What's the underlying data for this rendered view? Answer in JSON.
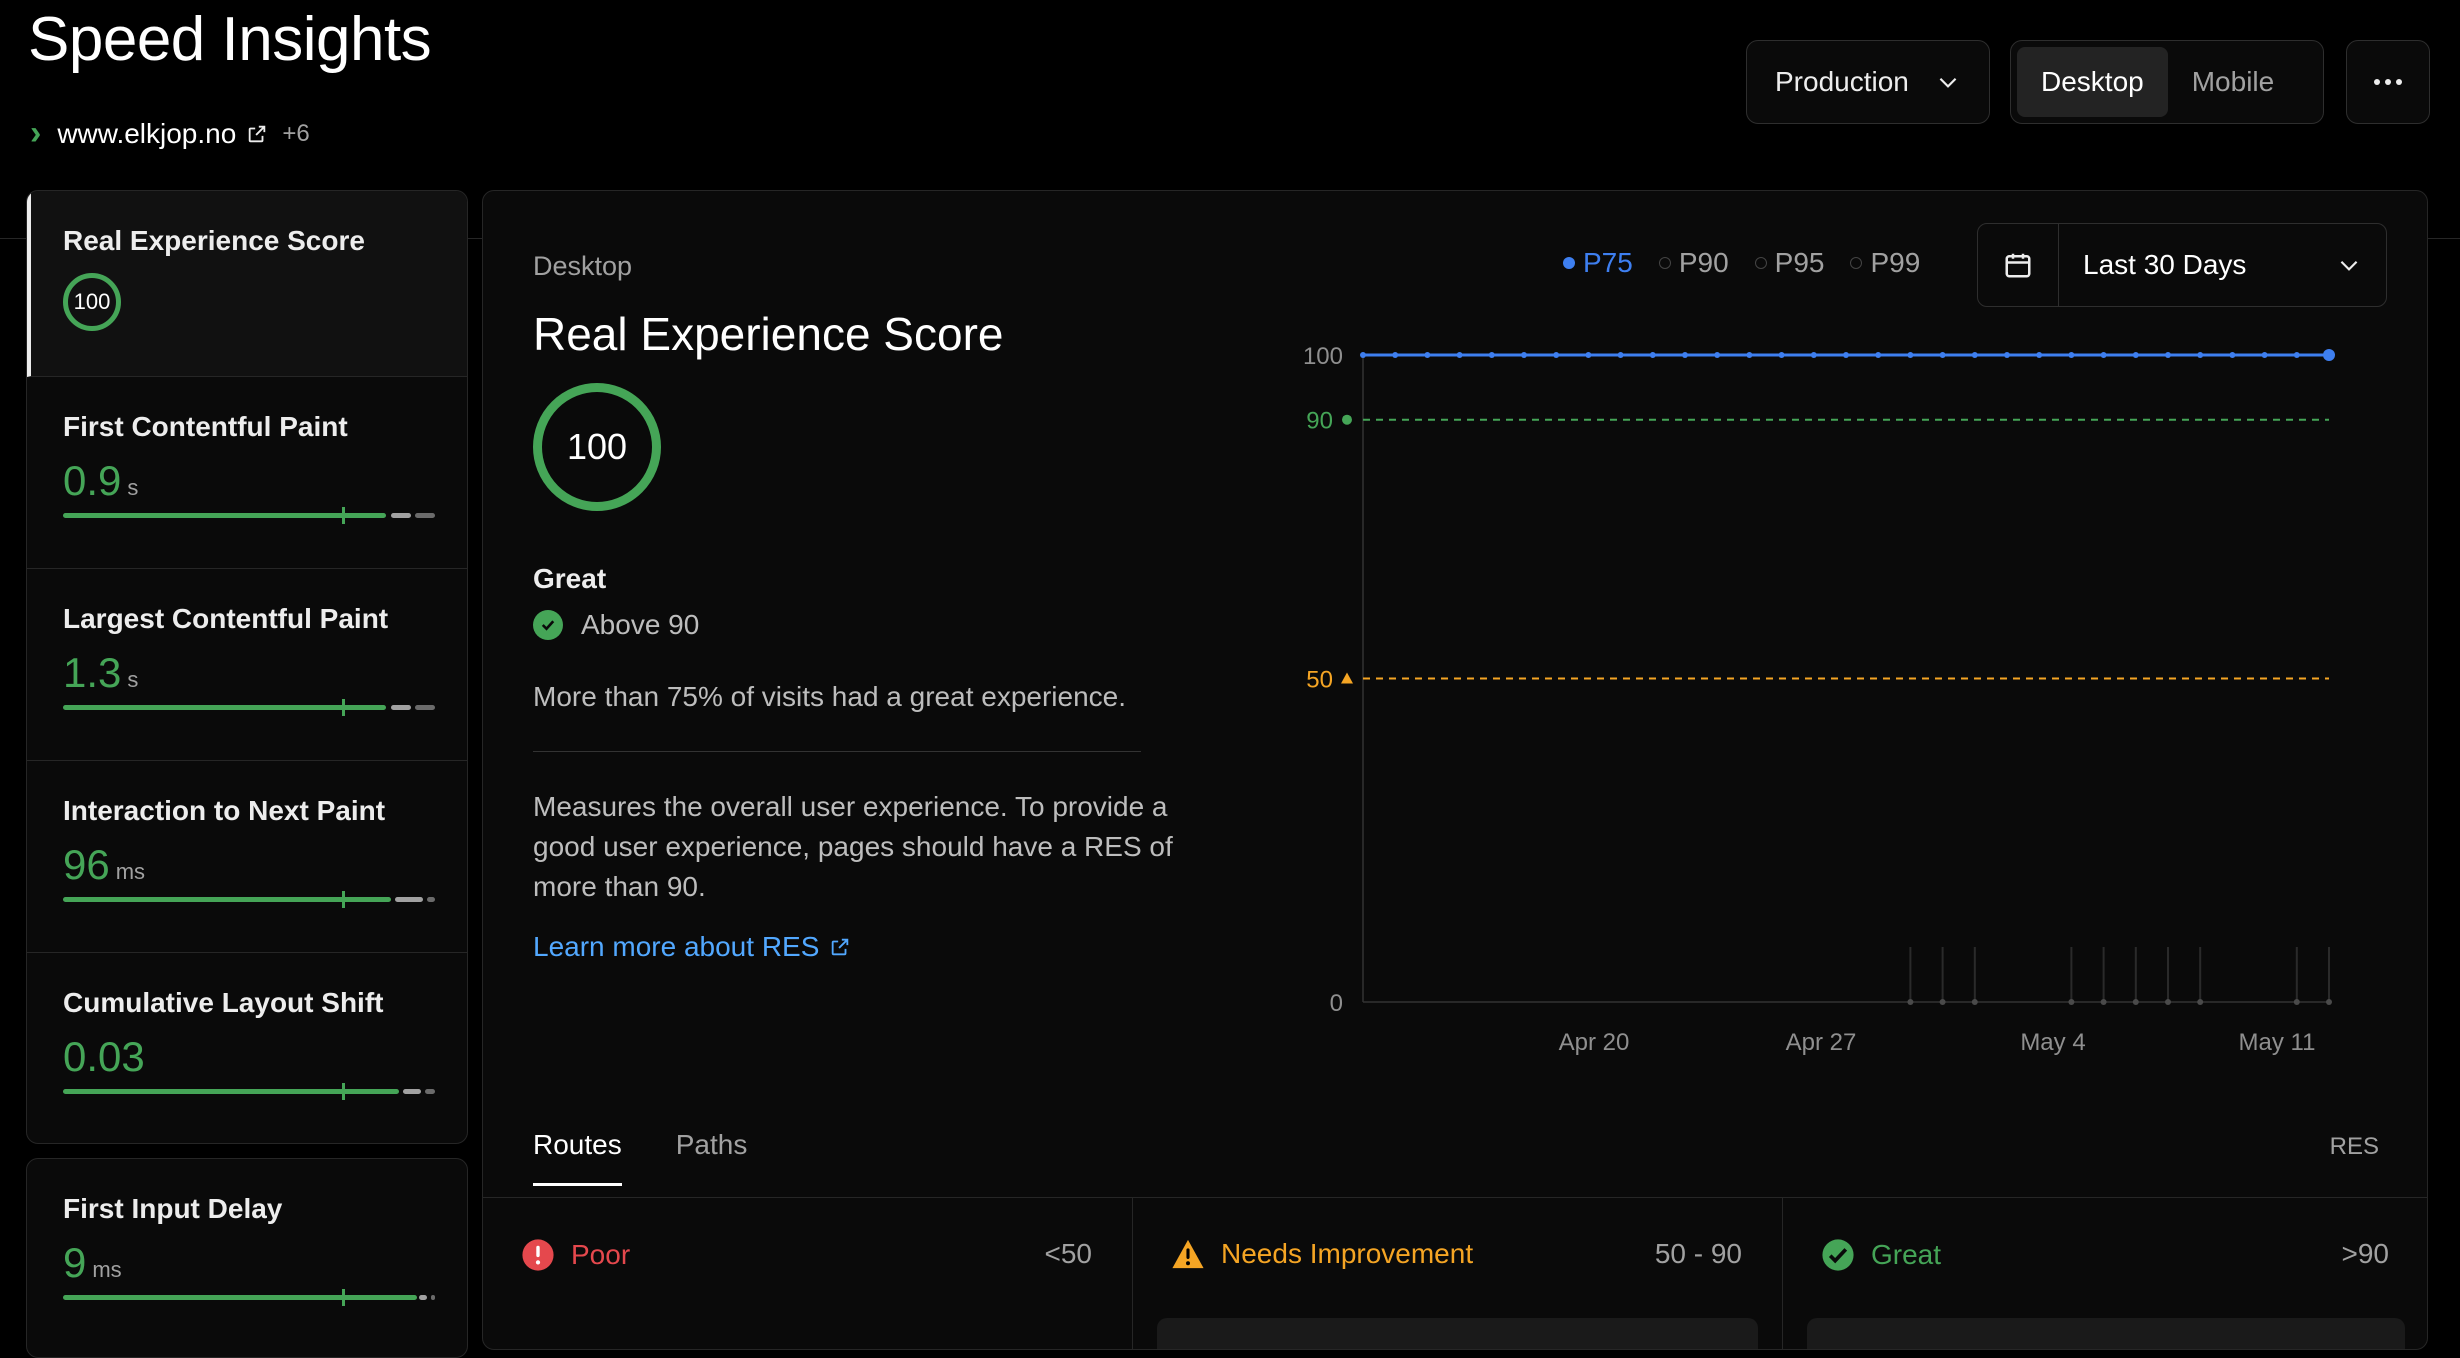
{
  "header": {
    "title": "Speed Insights",
    "domain": "www.elkjop.no",
    "more_count": "+6",
    "environment": "Production",
    "device_tabs": [
      {
        "label": "Desktop",
        "active": true
      },
      {
        "label": "Mobile",
        "active": false
      }
    ]
  },
  "sidebar": {
    "metrics": [
      {
        "name": "Real Experience Score",
        "score": "100"
      },
      {
        "name": "First Contentful Paint",
        "value": "0.9",
        "unit": "s"
      },
      {
        "name": "Largest Contentful Paint",
        "value": "1.3",
        "unit": "s"
      },
      {
        "name": "Interaction to Next Paint",
        "value": "96",
        "unit": "ms"
      },
      {
        "name": "Cumulative Layout Shift",
        "value": "0.03",
        "unit": ""
      },
      {
        "name": "First Input Delay",
        "value": "9",
        "unit": "ms"
      }
    ]
  },
  "panel": {
    "device": "Desktop",
    "title": "Real Experience Score",
    "score": "100",
    "rating": "Great",
    "threshold_text": "Above 90",
    "summary": "More than 75% of visits had a great experience.",
    "description": "Measures the overall user experience. To provide a good user experience, pages should have a RES of more than 90.",
    "learn_more": "Learn more about RES",
    "percentiles": [
      {
        "label": "P75",
        "active": true
      },
      {
        "label": "P90",
        "active": false
      },
      {
        "label": "P95",
        "active": false
      },
      {
        "label": "P99",
        "active": false
      }
    ],
    "date_range": "Last 30 Days",
    "tabs": [
      {
        "label": "Routes",
        "active": true
      },
      {
        "label": "Paths",
        "active": false
      }
    ],
    "res_label": "RES",
    "buckets": [
      {
        "label": "Poor",
        "range": "<50",
        "color": "#e5484d"
      },
      {
        "label": "Needs Improvement",
        "range": "50 - 90",
        "color": "#f5a524"
      },
      {
        "label": "Great",
        "range": ">90",
        "color": "#45a557"
      }
    ]
  },
  "chart_data": {
    "type": "line",
    "x_tick_labels": [
      "Apr 20",
      "Apr 27",
      "May 4",
      "May 11"
    ],
    "y_ticks": [
      0,
      90,
      50,
      100
    ],
    "ylim": [
      0,
      100
    ],
    "thresholds": [
      {
        "value": 90,
        "label": "90",
        "color": "#45a557"
      },
      {
        "value": 50,
        "label": "50",
        "color": "#f5a524"
      }
    ],
    "series": [
      {
        "name": "P75",
        "color": "#3e7ff0",
        "values": [
          100,
          100,
          100,
          100,
          100,
          100,
          100,
          100,
          100,
          100,
          100,
          100,
          100,
          100,
          100,
          100,
          100,
          100,
          100,
          100,
          100,
          100,
          100,
          100,
          100,
          100,
          100,
          100,
          100,
          100,
          100
        ]
      }
    ]
  }
}
